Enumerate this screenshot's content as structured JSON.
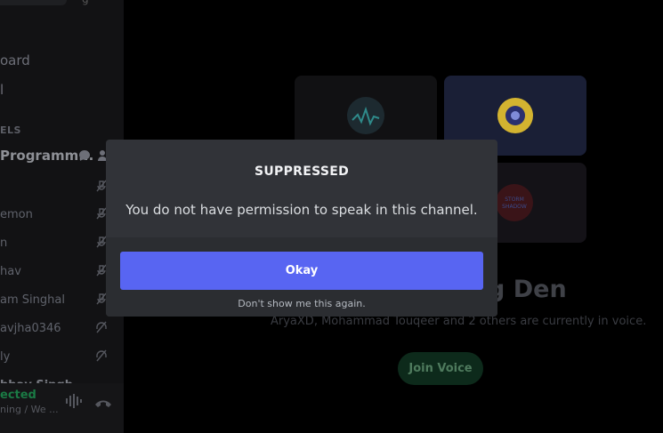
{
  "sidebar": {
    "nav_items": [
      "oard",
      "l"
    ],
    "section_header": "ELS",
    "channel_name": "Programm...",
    "members": [
      {
        "name": ""
      },
      {
        "name": "emon"
      },
      {
        "name": "n"
      },
      {
        "name": "hav"
      },
      {
        "name": "am Singhal"
      },
      {
        "name": "avjha0346"
      },
      {
        "name": "ly"
      },
      {
        "name": "bhav Singh"
      }
    ],
    "voice_status": "ected",
    "voice_channel": "ning / We ..."
  },
  "main": {
    "room_title": "g Den",
    "room_subtitle": "AryaXD, Mohammad Touqeer and 2 others are currently in voice.",
    "join_label": "Join Voice",
    "avatar_text": "STORM\nSHADOW"
  },
  "modal": {
    "title": "SUPPRESSED",
    "message": "You do not have permission to speak in this channel.",
    "okay_label": "Okay",
    "dont_show_label": "Don't show me this again."
  },
  "colors": {
    "accent": "#5865f2",
    "modal_bg": "#313338",
    "footer_bg": "#2b2d31",
    "connected_green": "#23a55a"
  }
}
